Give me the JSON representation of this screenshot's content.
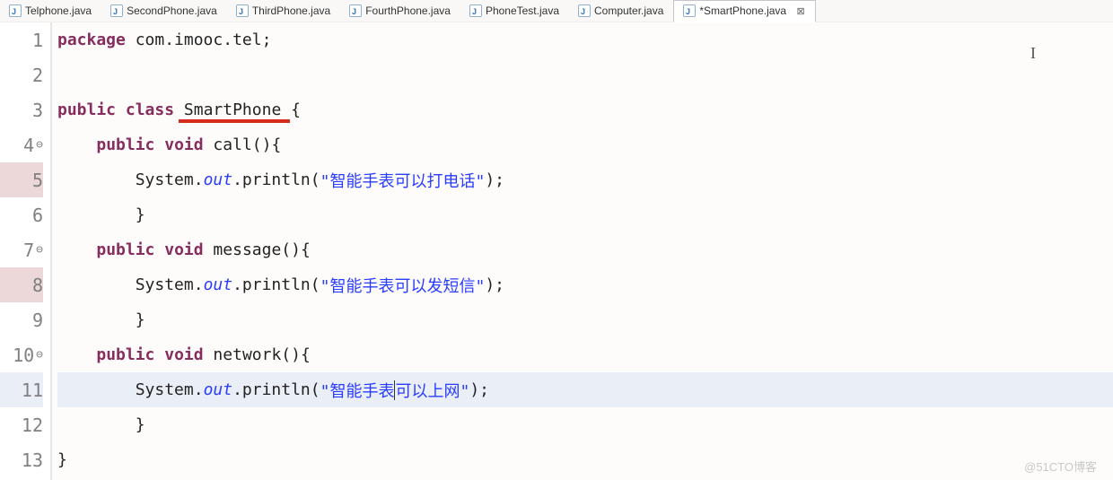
{
  "tabs": [
    {
      "label": "Telphone.java",
      "active": false
    },
    {
      "label": "SecondPhone.java",
      "active": false
    },
    {
      "label": "ThirdPhone.java",
      "active": false
    },
    {
      "label": "FourthPhone.java",
      "active": false
    },
    {
      "label": "PhoneTest.java",
      "active": false
    },
    {
      "label": "Computer.java",
      "active": false
    },
    {
      "label": "*SmartPhone.java",
      "active": true
    }
  ],
  "close_glyph": "⊠",
  "lines": {
    "l1": {
      "num": "1",
      "pkg_kw": "package",
      "pkg_name": " com.imooc.tel;"
    },
    "l2": {
      "num": "2"
    },
    "l3": {
      "num": "3",
      "kw1": "public",
      "kw2": "class",
      "name": "SmartPhone",
      "brace": " {"
    },
    "l4": {
      "num": "4",
      "kw1": "public",
      "kw2": "void",
      "name": " call(){"
    },
    "l5": {
      "num": "5",
      "obj": "System.",
      "field": "out",
      "method": ".println(",
      "str": "\"智能手表可以打电话\"",
      "end": ");"
    },
    "l6": {
      "num": "6",
      "text": "        }"
    },
    "l7": {
      "num": "7",
      "kw1": "public",
      "kw2": "void",
      "name": " message(){"
    },
    "l8": {
      "num": "8",
      "obj": "System.",
      "field": "out",
      "method": ".println(",
      "str": "\"智能手表可以发短信\"",
      "end": ");"
    },
    "l9": {
      "num": "9",
      "text": "        }"
    },
    "l10": {
      "num": "10",
      "kw1": "public",
      "kw2": "void",
      "name": " network(){"
    },
    "l11": {
      "num": "11",
      "obj": "System.",
      "field": "out",
      "method": ".println(",
      "str1": "\"智能手表",
      "str2": "可以上网\"",
      "end": ");"
    },
    "l12": {
      "num": "12",
      "text": "        }"
    },
    "l13": {
      "num": "13",
      "text": "}"
    }
  },
  "watermark": "@51CTO博客"
}
